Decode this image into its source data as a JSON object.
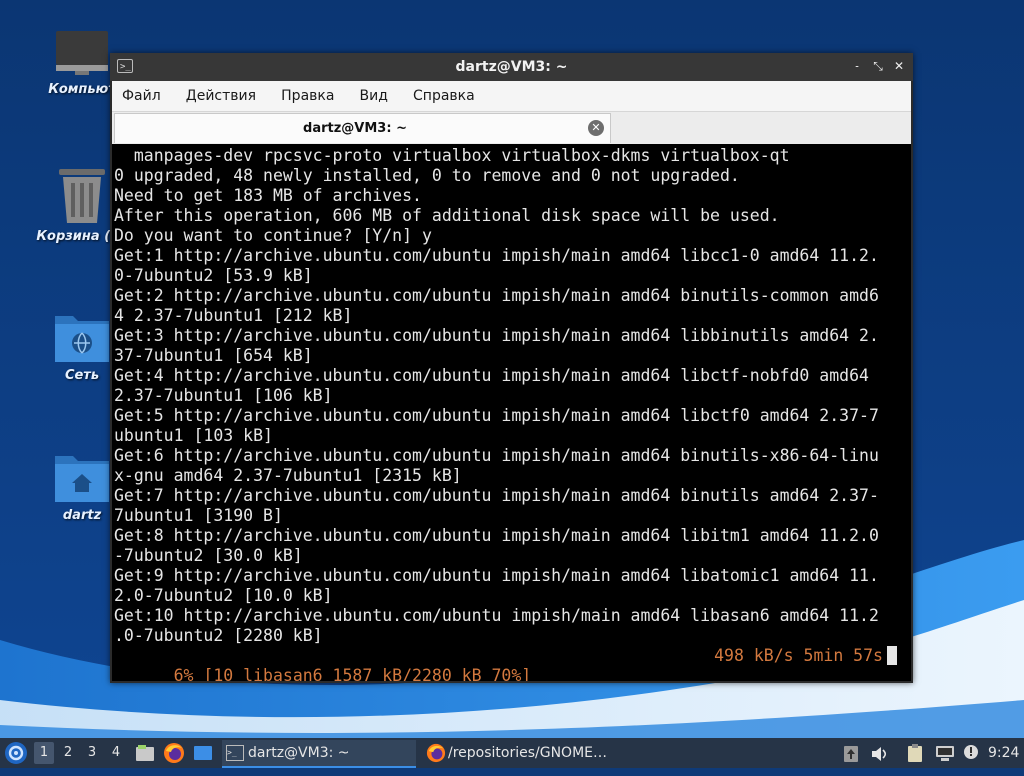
{
  "desktop": {
    "icons": [
      {
        "label": "Компьют",
        "icon": "computer-icon"
      },
      {
        "label": "Корзина (пу",
        "icon": "trash-icon"
      },
      {
        "label": "Сеть",
        "icon": "network-folder-icon"
      },
      {
        "label": "dartz",
        "icon": "home-folder-icon"
      }
    ]
  },
  "window": {
    "title": "dartz@VM3: ~",
    "controls": {
      "minimize": "˗",
      "maximize": "⤡",
      "close": "✕"
    },
    "menu": [
      "Файл",
      "Действия",
      "Правка",
      "Вид",
      "Справка"
    ],
    "tab": {
      "title": "dartz@VM3: ~",
      "close": "✕"
    }
  },
  "terminal": {
    "lines": [
      "  manpages-dev rpcsvc-proto virtualbox virtualbox-dkms virtualbox-qt",
      "0 upgraded, 48 newly installed, 0 to remove and 0 not upgraded.",
      "Need to get 183 MB of archives.",
      "After this operation, 606 MB of additional disk space will be used.",
      "Do you want to continue? [Y/n] y",
      "Get:1 http://archive.ubuntu.com/ubuntu impish/main amd64 libcc1-0 amd64 11.2.",
      "0-7ubuntu2 [53.9 kB]",
      "Get:2 http://archive.ubuntu.com/ubuntu impish/main amd64 binutils-common amd6",
      "4 2.37-7ubuntu1 [212 kB]",
      "Get:3 http://archive.ubuntu.com/ubuntu impish/main amd64 libbinutils amd64 2.",
      "37-7ubuntu1 [654 kB]",
      "Get:4 http://archive.ubuntu.com/ubuntu impish/main amd64 libctf-nobfd0 amd64",
      "2.37-7ubuntu1 [106 kB]",
      "Get:5 http://archive.ubuntu.com/ubuntu impish/main amd64 libctf0 amd64 2.37-7",
      "ubuntu1 [103 kB]",
      "Get:6 http://archive.ubuntu.com/ubuntu impish/main amd64 binutils-x86-64-linu",
      "x-gnu amd64 2.37-7ubuntu1 [2315 kB]",
      "Get:7 http://archive.ubuntu.com/ubuntu impish/main amd64 binutils amd64 2.37-",
      "7ubuntu1 [3190 B]",
      "Get:8 http://archive.ubuntu.com/ubuntu impish/main amd64 libitm1 amd64 11.2.0",
      "-7ubuntu2 [30.0 kB]",
      "Get:9 http://archive.ubuntu.com/ubuntu impish/main amd64 libatomic1 amd64 11.",
      "2.0-7ubuntu2 [10.0 kB]",
      "Get:10 http://archive.ubuntu.com/ubuntu impish/main amd64 libasan6 amd64 11.2",
      ".0-7ubuntu2 [2280 kB]"
    ],
    "progress": {
      "status": "6% [10 libasan6 1587 kB/2280 kB 70%]",
      "rate": "498 kB/s 5min 57s",
      "percent": 6
    },
    "colors": {
      "background": "#000000",
      "text": "#e6e6e6",
      "progress": "#d3793f"
    }
  },
  "taskbar": {
    "workspaces": [
      "1",
      "2",
      "3",
      "4"
    ],
    "active_workspace": "1",
    "tasks": [
      {
        "label": "dartz@VM3: ~",
        "icon": "terminal-icon",
        "active": true
      },
      {
        "label": "/repositories/GNOME…",
        "icon": "firefox-icon",
        "active": false
      }
    ],
    "clock": "9:24"
  }
}
